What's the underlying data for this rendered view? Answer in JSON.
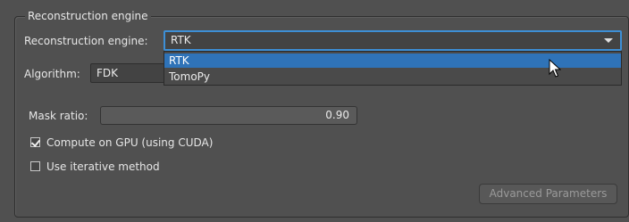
{
  "group": {
    "title": "Reconstruction engine"
  },
  "engine": {
    "label": "Reconstruction engine:",
    "selected": "RTK",
    "options": [
      "RTK",
      "TomoPy"
    ]
  },
  "algorithm": {
    "label": "Algorithm:",
    "selected": "FDK"
  },
  "mask": {
    "label": "Mask ratio:",
    "value": "0.90"
  },
  "gpu": {
    "label": "Compute on GPU (using CUDA)",
    "checked": true
  },
  "iterative": {
    "label": "Use iterative method",
    "checked": false
  },
  "advanced": {
    "label": "Advanced Parameters",
    "enabled": false
  }
}
